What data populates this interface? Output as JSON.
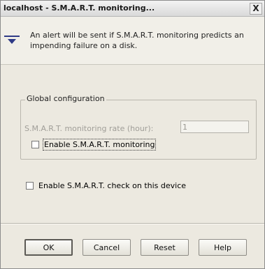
{
  "window": {
    "title": "localhost - S.M.A.R.T. monitoring...",
    "close_symbol": "X"
  },
  "banner": {
    "icon": "filter-icon",
    "text": "An alert will be sent if S.M.A.R.T. monitoring predicts an impending failure on a disk."
  },
  "global_config": {
    "legend": "Global configuration",
    "rate_label": "S.M.A.R.T. monitoring rate (hour):",
    "rate_value": "1",
    "enable_monitoring_label": "Enable S.M.A.R.T. monitoring",
    "enable_monitoring_checked": false
  },
  "device": {
    "enable_check_label": "Enable S.M.A.R.T. check on this device",
    "enable_check_checked": false
  },
  "buttons": {
    "ok": "OK",
    "cancel": "Cancel",
    "reset": "Reset",
    "help": "Help"
  },
  "colors": {
    "dialog_background": "#ece9e0",
    "icon_accent": "#2e3a86"
  }
}
